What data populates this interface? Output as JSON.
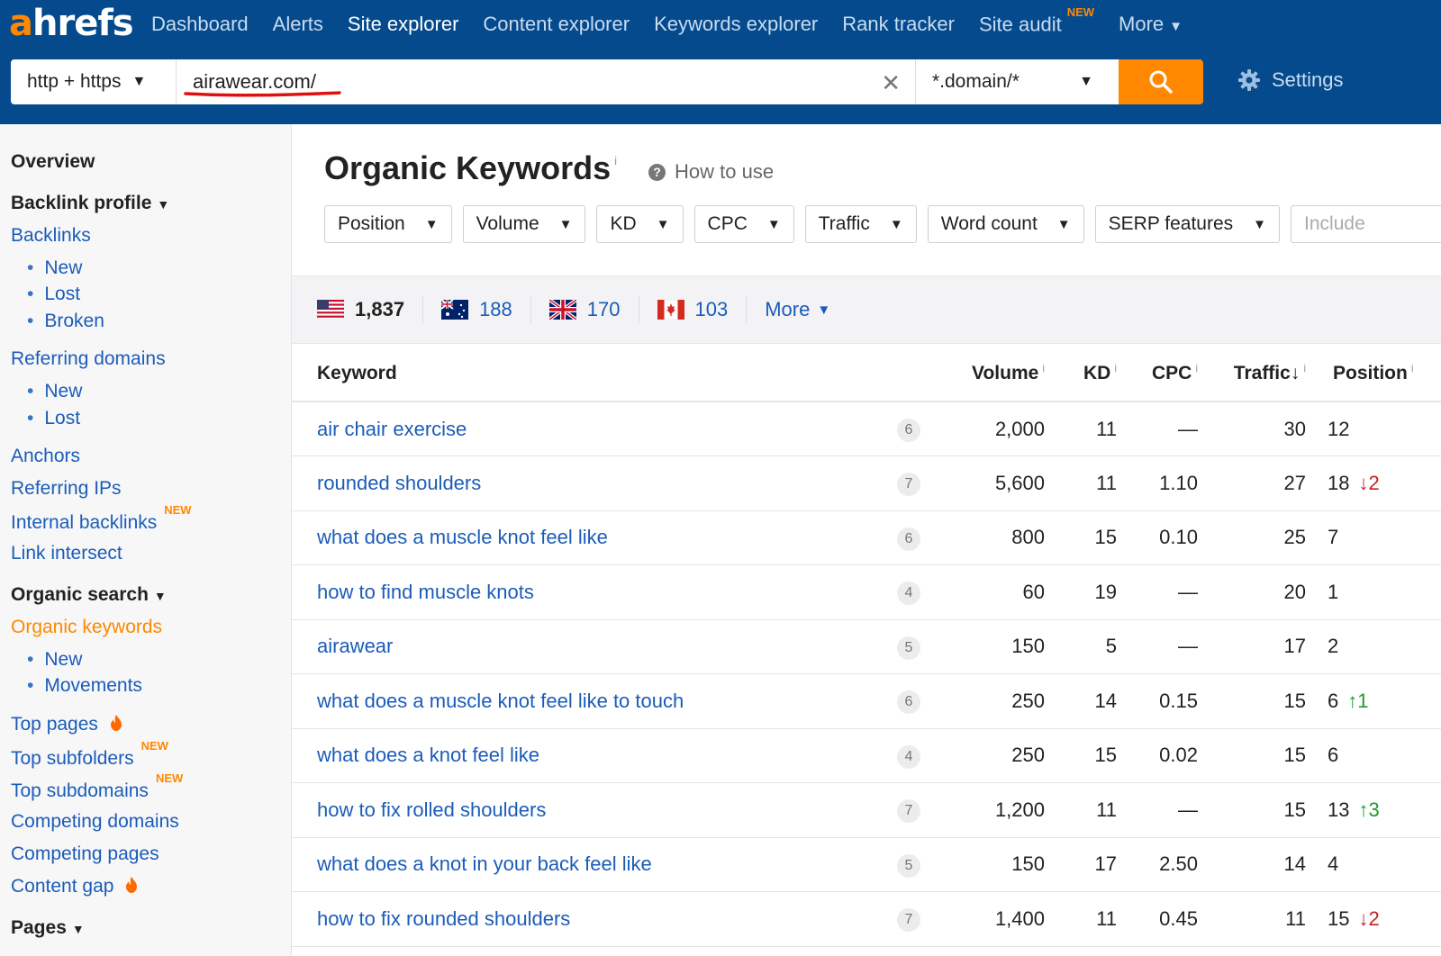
{
  "app": {
    "logo_a": "a",
    "logo_rest": "hrefs",
    "brand_color": "#ff8800",
    "nav_bg": "#054a8d"
  },
  "nav": {
    "items": [
      {
        "label": "Dashboard"
      },
      {
        "label": "Alerts"
      },
      {
        "label": "Site explorer",
        "active": true
      },
      {
        "label": "Content explorer"
      },
      {
        "label": "Keywords explorer"
      },
      {
        "label": "Rank tracker"
      },
      {
        "label": "Site audit",
        "badge": "NEW"
      },
      {
        "label": "More"
      }
    ]
  },
  "search": {
    "protocol": "http + https",
    "url": "airawear.com/",
    "mode": "*.domain/*",
    "search_icon": "search-icon",
    "settings_label": "Settings"
  },
  "sidebar": {
    "overview": "Overview",
    "backlink_profile": "Backlink profile",
    "backlinks": "Backlinks",
    "backlinks_new": "New",
    "backlinks_lost": "Lost",
    "backlinks_broken": "Broken",
    "referring_domains": "Referring domains",
    "refdomains_new": "New",
    "refdomains_lost": "Lost",
    "anchors": "Anchors",
    "referring_ips": "Referring IPs",
    "internal_backlinks": "Internal backlinks",
    "internal_backlinks_badge": "NEW",
    "link_intersect": "Link intersect",
    "organic_search": "Organic search",
    "organic_keywords": "Organic keywords",
    "organic_new": "New",
    "organic_movements": "Movements",
    "top_pages": "Top pages",
    "top_subfolders": "Top subfolders",
    "top_subfolders_badge": "NEW",
    "top_subdomains": "Top subdomains",
    "top_subdomains_badge": "NEW",
    "competing_domains": "Competing domains",
    "competing_pages": "Competing pages",
    "content_gap": "Content gap",
    "pages": "Pages"
  },
  "main": {
    "title": "Organic Keywords",
    "title_info": "i",
    "how_to_use": "How to use",
    "filters": [
      "Position",
      "Volume",
      "KD",
      "CPC",
      "Traffic",
      "Word count",
      "SERP features"
    ],
    "include_placeholder": "Include",
    "countries": [
      {
        "flag": "us-flag-icon",
        "count": "1,837"
      },
      {
        "flag": "au-flag-icon",
        "count": "188"
      },
      {
        "flag": "uk-flag-icon",
        "count": "170"
      },
      {
        "flag": "ca-flag-icon",
        "count": "103"
      }
    ],
    "countries_more": "More"
  },
  "table": {
    "headers": {
      "keyword": "Keyword",
      "volume": "Volume",
      "kd": "KD",
      "cpc": "CPC",
      "traffic": "Traffic",
      "traffic_sort": "↓",
      "position": "Position",
      "info": "i"
    },
    "rows": [
      {
        "keyword": "air chair exercise",
        "words": "6",
        "volume": "2,000",
        "kd": "11",
        "cpc": "—",
        "traffic": "30",
        "position": "12",
        "delta": "",
        "dir": ""
      },
      {
        "keyword": "rounded shoulders",
        "words": "7",
        "volume": "5,600",
        "kd": "11",
        "cpc": "1.10",
        "traffic": "27",
        "position": "18",
        "delta": "↓2",
        "dir": "down"
      },
      {
        "keyword": "what does a muscle knot feel like",
        "words": "6",
        "volume": "800",
        "kd": "15",
        "cpc": "0.10",
        "traffic": "25",
        "position": "7",
        "delta": "",
        "dir": ""
      },
      {
        "keyword": "how to find muscle knots",
        "words": "4",
        "volume": "60",
        "kd": "19",
        "cpc": "—",
        "traffic": "20",
        "position": "1",
        "delta": "",
        "dir": ""
      },
      {
        "keyword": "airawear",
        "words": "5",
        "volume": "150",
        "kd": "5",
        "cpc": "—",
        "traffic": "17",
        "position": "2",
        "delta": "",
        "dir": ""
      },
      {
        "keyword": "what does a muscle knot feel like to touch",
        "words": "6",
        "volume": "250",
        "kd": "14",
        "cpc": "0.15",
        "traffic": "15",
        "position": "6",
        "delta": "↑1",
        "dir": "up"
      },
      {
        "keyword": "what does a knot feel like",
        "words": "4",
        "volume": "250",
        "kd": "15",
        "cpc": "0.02",
        "traffic": "15",
        "position": "6",
        "delta": "",
        "dir": ""
      },
      {
        "keyword": "how to fix rolled shoulders",
        "words": "7",
        "volume": "1,200",
        "kd": "11",
        "cpc": "—",
        "traffic": "15",
        "position": "13",
        "delta": "↑3",
        "dir": "up"
      },
      {
        "keyword": "what does a knot in your back feel like",
        "words": "5",
        "volume": "150",
        "kd": "17",
        "cpc": "2.50",
        "traffic": "14",
        "position": "4",
        "delta": "",
        "dir": ""
      },
      {
        "keyword": "how to fix rounded shoulders",
        "words": "7",
        "volume": "1,400",
        "kd": "11",
        "cpc": "0.45",
        "traffic": "11",
        "position": "15",
        "delta": "↓2",
        "dir": "down"
      }
    ]
  }
}
